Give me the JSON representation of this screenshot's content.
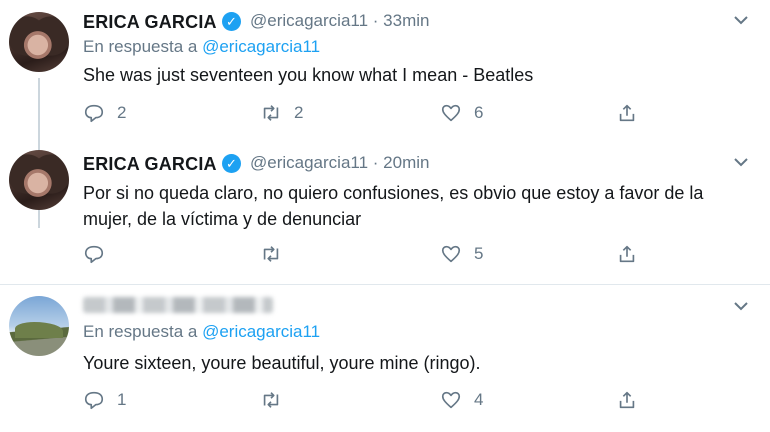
{
  "tweets": [
    {
      "name": "ERICA GARCIA",
      "handle_time": "@ericagarcia11 · 33min",
      "reply_prefix": "En respuesta a ",
      "reply_mention": "@ericagarcia11",
      "text": "She was just seventeen you know what I mean - Beatles",
      "replies": "2",
      "retweets": "2",
      "likes": "6"
    },
    {
      "name": "ERICA GARCIA",
      "handle_time": "@ericagarcia11 · 20min",
      "text": "Por si no queda claro, no quiero confusiones, es obvio que estoy a favor de la mujer, de la víctima y de denunciar",
      "replies": "",
      "retweets": "",
      "likes": "5"
    },
    {
      "name": "",
      "reply_prefix": "En respuesta a ",
      "reply_mention": "@ericagarcia11",
      "text": "Youre sixteen, youre beautiful, youre mine (ringo).",
      "replies": "1",
      "retweets": "",
      "likes": "4"
    }
  ],
  "colors": {
    "accent": "#1da1f2",
    "muted": "#657786",
    "text": "#14171a"
  },
  "icons": [
    "verified-badge-icon",
    "chevron-down-icon",
    "reply-icon",
    "retweet-icon",
    "like-icon",
    "share-icon"
  ]
}
